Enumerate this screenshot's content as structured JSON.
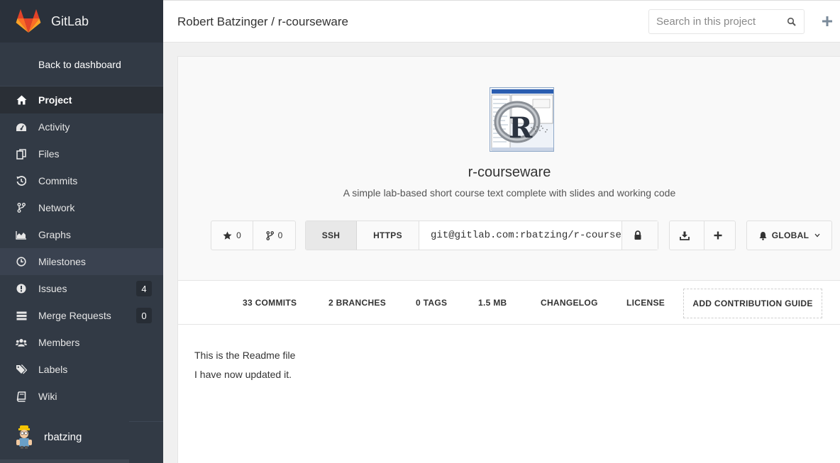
{
  "app": {
    "name": "GitLab"
  },
  "sidebar": {
    "back_label": "Back to dashboard",
    "items": [
      {
        "label": "Project",
        "icon": "home-icon",
        "active": true
      },
      {
        "label": "Activity",
        "icon": "dashboard-icon"
      },
      {
        "label": "Files",
        "icon": "files-icon"
      },
      {
        "label": "Commits",
        "icon": "history-icon"
      },
      {
        "label": "Network",
        "icon": "code-fork-icon"
      },
      {
        "label": "Graphs",
        "icon": "area-chart-icon"
      },
      {
        "label": "Milestones",
        "icon": "clock-icon"
      },
      {
        "label": "Issues",
        "icon": "exclamation-circle-icon",
        "count": "4"
      },
      {
        "label": "Merge Requests",
        "icon": "tasks-icon",
        "count": "0"
      },
      {
        "label": "Members",
        "icon": "users-icon"
      },
      {
        "label": "Labels",
        "icon": "tags-icon"
      },
      {
        "label": "Wiki",
        "icon": "book-icon"
      }
    ],
    "user": {
      "name": "rbatzing"
    }
  },
  "header": {
    "breadcrumb": "Robert Batzinger / r-courseware",
    "search_placeholder": "Search in this project"
  },
  "project": {
    "title": "r-courseware",
    "description": "A simple lab-based short course text complete with slides and working code",
    "stars": "0",
    "forks": "0",
    "clone": {
      "ssh_label": "SSH",
      "https_label": "HTTPS",
      "url": "git@gitlab.com:rbatzing/r-courseware.git"
    },
    "notification_label": "GLOBAL"
  },
  "stats": {
    "commits": "33 COMMITS",
    "branches": "2 BRANCHES",
    "tags": "0 TAGS",
    "size": "1.5 MB",
    "changelog": "CHANGELOG",
    "license": "LICENSE",
    "contribution": "ADD CONTRIBUTION GUIDE"
  },
  "readme": {
    "lines": [
      "This is the Readme file",
      "I have now updated it."
    ]
  },
  "colors": {
    "sidebar_bg": "#323a45",
    "sidebar_brand_bg": "#2a313b",
    "accent_orange": "#e24329"
  }
}
